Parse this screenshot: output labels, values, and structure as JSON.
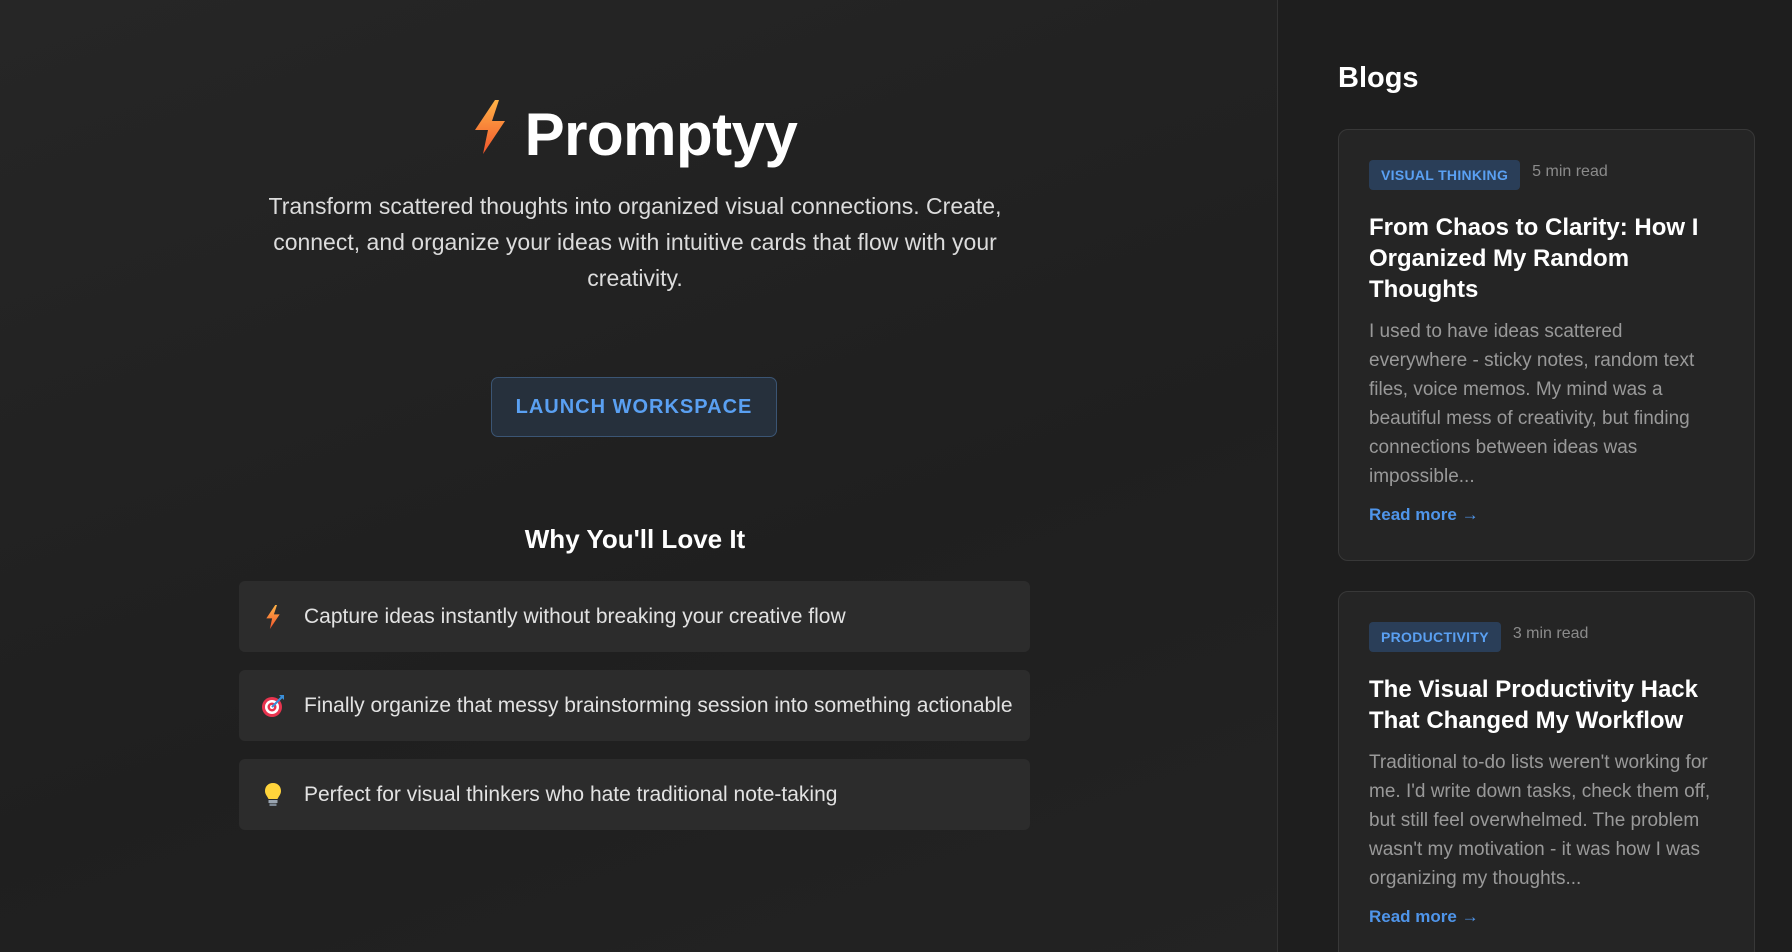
{
  "app": {
    "name": "Promptyy",
    "tagline": "Transform scattered thoughts into organized visual connections. Create, connect, and organize your ideas with intuitive cards that flow with your creativity.",
    "launch_label": "LAUNCH WORKSPACE",
    "logo_icon": "lightning-bolt-icon"
  },
  "features": {
    "heading": "Why You'll Love It",
    "items": [
      {
        "icon": "lightning-bolt-icon",
        "text": "Capture ideas instantly without breaking your creative flow"
      },
      {
        "icon": "target-dart-icon",
        "text": "Finally organize that messy brainstorming session into something actionable"
      },
      {
        "icon": "light-bulb-icon",
        "text": "Perfect for visual thinkers who hate traditional note-taking"
      }
    ]
  },
  "blogs": {
    "heading": "Blogs",
    "posts": [
      {
        "tag": "VISUAL THINKING",
        "read_time": "5 min read",
        "title": "From Chaos to Clarity: How I Organized My Random Thoughts",
        "excerpt": "I used to have ideas scattered everywhere - sticky notes, random text files, voice memos. My mind was a beautiful mess of creativity, but finding connections between ideas was impossible...",
        "read_more": "Read more →"
      },
      {
        "tag": "PRODUCTIVITY",
        "read_time": "3 min read",
        "title": "The Visual Productivity Hack That Changed My Workflow",
        "excerpt": "Traditional to-do lists weren't working for me. I'd write down tasks, check them off, but still feel overwhelmed. The problem wasn't my motivation - it was how I was organizing my thoughts...",
        "read_more": "Read more →"
      }
    ]
  },
  "colors": {
    "accent": "#5aa0f2",
    "background": "#222222",
    "card": "#2c2c2c"
  }
}
